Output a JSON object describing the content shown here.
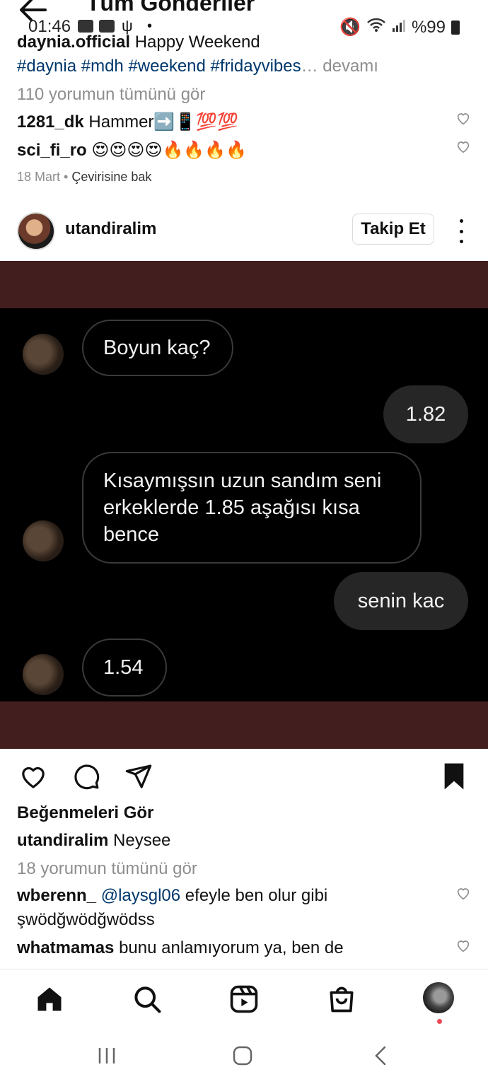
{
  "header": {
    "title": "Tüm Gönderiler"
  },
  "status_bar": {
    "time": "01:46",
    "battery": "%99"
  },
  "prev_post": {
    "caption_user": "daynia.official",
    "caption_text": "Happy Weekend",
    "hashtags": "#daynia #mdh #weekend #fridayvibes",
    "more_label": "… devamı",
    "view_comments": "110 yorumun tümünü gör",
    "comments": [
      {
        "user": "1281_dk",
        "text": "Hammer➡️📱💯💯"
      },
      {
        "user": "sci_fi_ro",
        "text": "😍😍😍😍🔥🔥🔥🔥"
      }
    ],
    "date": "18 Mart",
    "translate": "Çevirisine bak"
  },
  "post": {
    "username": "utandiralim",
    "follow_label": "Takip Et",
    "messages": [
      {
        "from": "them",
        "text": "Boyun kaç?"
      },
      {
        "from": "me",
        "text": "1.82"
      },
      {
        "from": "them",
        "text": "Kısaymışsın uzun sandım seni erkeklerde 1.85 aşağısı kısa bence"
      },
      {
        "from": "me",
        "text": "senin kac"
      },
      {
        "from": "them",
        "text": "1.54"
      }
    ],
    "likes_label": "Beğenmeleri Gör",
    "caption_user": "utandiralim",
    "caption_text": "Neysee",
    "view_comments": "18 yorumun tümünü gör",
    "comments": [
      {
        "user": "wberenn_",
        "mention": "@laysgl06",
        "text": "efeyle ben olur gibi",
        "text2": "şwödğwödğwödss"
      },
      {
        "user": "whatmamas",
        "text": "bunu anlamıyorum ya, ben de"
      }
    ]
  },
  "colors": {
    "image_bg": "#431e1f",
    "chat_bg": "#000000",
    "out_bubble": "#262626",
    "hashtag": "#00376b",
    "notif_dot": "#ed4956"
  }
}
